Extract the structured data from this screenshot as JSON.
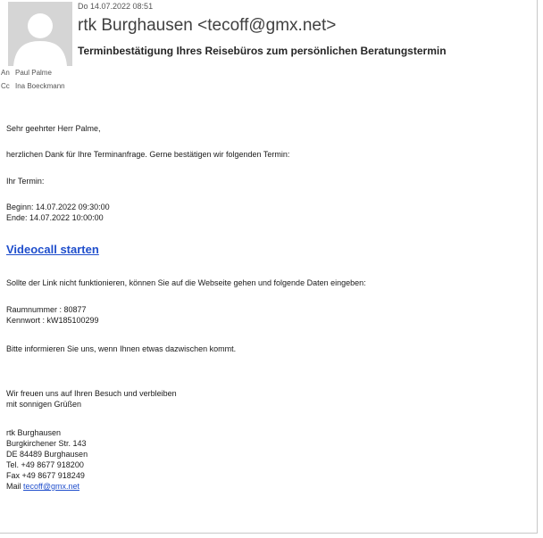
{
  "header": {
    "date": "Do 14.07.2022 08:51",
    "sender": "rtk Burghausen <tecoff@gmx.net>",
    "subject": "Terminbestätigung Ihres Reisebüros zum persönlichen Beratungstermin",
    "to_label": "An",
    "to_value": "Paul Palme",
    "cc_label": "Cc",
    "cc_value": "Ina Boeckmann",
    "avatar_icon": "person-placeholder-icon"
  },
  "body": {
    "greeting": "Sehr geehrter Herr Palme,",
    "thanks": "herzlichen Dank für Ihre Terminanfrage. Gerne bestätigen wir folgenden Termin:",
    "termin_label": "Ihr Termin:",
    "start": "Beginn: 14.07.2022 09:30:00",
    "end": "Ende: 14.07.2022 10:00:00",
    "video_link": "Videocall starten",
    "fallback": "Sollte der Link nicht funktionieren, können Sie auf die Webseite gehen und folgende Daten eingeben:",
    "room": "Raumnummer : 80877",
    "password": "Kennwort : kW185100299",
    "inform": "Bitte informieren Sie uns, wenn Ihnen etwas dazwischen kommt.",
    "looking_forward": "Wir freuen uns auf Ihren Besuch und verbleiben",
    "regards": "mit sonnigen Grüßen",
    "signature": {
      "name": "rtk Burghausen",
      "street": "Burgkirchener Str. 143",
      "city": "DE 84489 Burghausen",
      "tel": "Tel. +49 8677 918200",
      "fax": "Fax +49 8677 918249",
      "mail_label": "Mail",
      "mail": "tecoff@gmx.net"
    }
  },
  "colors": {
    "link": "#1f4ecc",
    "avatar_bg": "#d5d5d5",
    "avatar_fg": "#ffffff"
  }
}
